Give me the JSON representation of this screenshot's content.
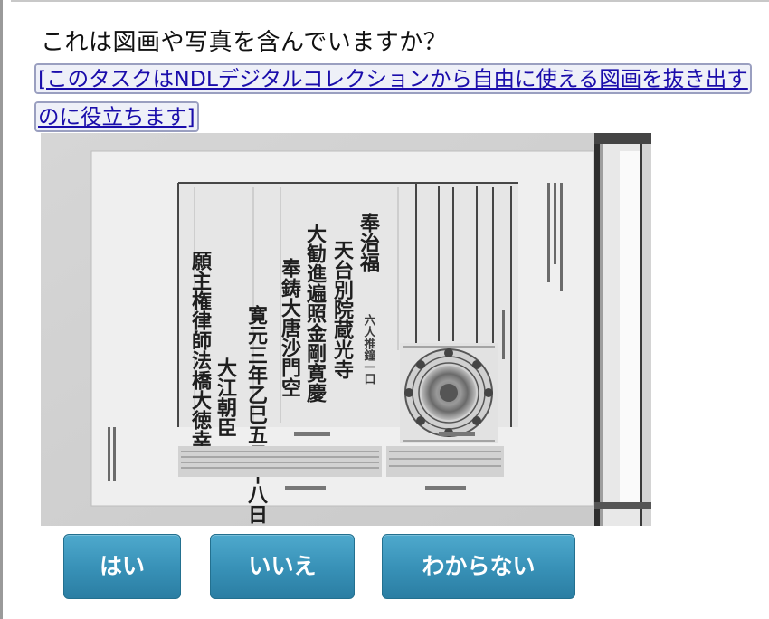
{
  "question": "これは図画や写真を含んでいますか？",
  "help_link": "[このタスクはNDLデジタルコレクションから自由に使える図画を抜き出すのに役立ちます]",
  "scan": {
    "title_lines": [
      "奉治福",
      "天台別院蔵光寺",
      "大勧進遍照金剛寛慶",
      "奉鋳大唐沙門空",
      "寛元三年乙巳五月十八日",
      "大江朝臣",
      "願主権律師法橋大徳幸助"
    ],
    "side_label": "六人推鐘一口"
  },
  "answers": {
    "yes": "はい",
    "no": "いいえ",
    "unknown": "わからない"
  }
}
